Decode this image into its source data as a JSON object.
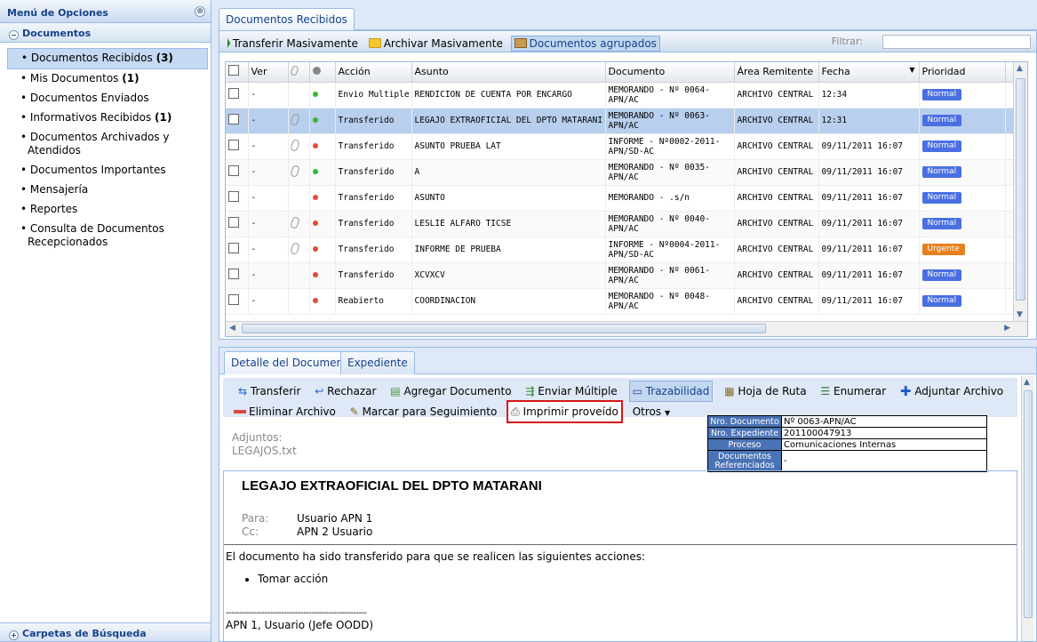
{
  "left": {
    "title": "Menú de Opciones",
    "close_glyph": "⊗",
    "section": "Documentos",
    "section_toggle": "−",
    "items": [
      {
        "label": "• Documentos Recibidos",
        "count": "(3)"
      },
      {
        "label": "• Mis Documentos",
        "count": "(1)"
      },
      {
        "label": "• Documentos Enviados",
        "count": ""
      },
      {
        "label": "• Informativos Recibidos",
        "count": "(1)"
      },
      {
        "label": "• Documentos Archivados y Atendidos",
        "count": ""
      },
      {
        "label": "• Documentos Importantes",
        "count": ""
      },
      {
        "label": "• Mensajería",
        "count": ""
      },
      {
        "label": "• Reportes",
        "count": ""
      },
      {
        "label": "• Consulta de Documentos Recepcionados",
        "count": ""
      }
    ],
    "bottom_section": "Carpetas de Búsqueda",
    "bottom_toggle": "+"
  },
  "main_tab": "Documentos Recibidos",
  "toolbar": {
    "transfer": "Transferir Masivamente",
    "archive": "Archivar Masivamente",
    "grouped": "Documentos agrupados",
    "filter_label": "Filtrar:",
    "filter_value": ""
  },
  "grid": {
    "headers": [
      "",
      "Ver",
      "",
      "",
      "Acción",
      "Asunto",
      "Documento",
      "Área Remitente",
      "Fecha",
      "Prioridad",
      ""
    ],
    "rows": [
      {
        "ver": "-",
        "clip": false,
        "status": "green",
        "accion": "Envio Multiple",
        "asunto": "RENDICION DE CUENTA POR ENCARGO",
        "documento": "MEMORANDO - Nº 0064-APN/AC",
        "area": "ARCHIVO CENTRAL",
        "fecha": "12:34",
        "prioridad": "Normal"
      },
      {
        "ver": "-",
        "clip": true,
        "status": "green",
        "accion": "Transferido",
        "asunto": "LEGAJO EXTRAOFICIAL DEL DPTO MATARANI",
        "documento": "MEMORANDO - Nº 0063-APN/AC",
        "area": "ARCHIVO CENTRAL",
        "fecha": "12:31",
        "prioridad": "Normal"
      },
      {
        "ver": "-",
        "clip": true,
        "status": "red",
        "accion": "Transferido",
        "asunto": "ASUNTO PRUEBA LAT",
        "documento": "INFORME - Nº0002-2011-APN/SD-AC",
        "area": "ARCHIVO CENTRAL",
        "fecha": "09/11/2011 16:07",
        "prioridad": "Normal"
      },
      {
        "ver": "-",
        "clip": true,
        "status": "green",
        "accion": "Transferido",
        "asunto": "A",
        "documento": "MEMORANDO - Nº 0035-APN/AC",
        "area": "ARCHIVO CENTRAL",
        "fecha": "09/11/2011 16:07",
        "prioridad": "Normal"
      },
      {
        "ver": "-",
        "clip": false,
        "status": "red",
        "accion": "Transferido",
        "asunto": "ASUNTO",
        "documento": "MEMORANDO - .s/n",
        "area": "ARCHIVO CENTRAL",
        "fecha": "09/11/2011 16:07",
        "prioridad": "Normal"
      },
      {
        "ver": "-",
        "clip": true,
        "status": "red",
        "accion": "Transferido",
        "asunto": "LESLIE ALFARO TICSE",
        "documento": "MEMORANDO - Nº 0040-APN/AC",
        "area": "ARCHIVO CENTRAL",
        "fecha": "09/11/2011 16:07",
        "prioridad": "Normal"
      },
      {
        "ver": "-",
        "clip": true,
        "status": "red",
        "accion": "Transferido",
        "asunto": "INFORME DE PRUEBA",
        "documento": "INFORME - Nº0004-2011-APN/SD-AC",
        "area": "ARCHIVO CENTRAL",
        "fecha": "09/11/2011 16:07",
        "prioridad": "Urgente"
      },
      {
        "ver": "-",
        "clip": false,
        "status": "red",
        "accion": "Transferido",
        "asunto": "XCVXCV",
        "documento": "MEMORANDO - Nº 0061-APN/AC",
        "area": "ARCHIVO CENTRAL",
        "fecha": "09/11/2011 16:07",
        "prioridad": "Normal"
      },
      {
        "ver": "-",
        "clip": false,
        "status": "red",
        "accion": "Reabierto",
        "asunto": "COORDINACION",
        "documento": "MEMORANDO - Nº 0048-APN/AC",
        "area": "ARCHIVO CENTRAL",
        "fecha": "09/11/2011 16:07",
        "prioridad": "Normal"
      }
    ]
  },
  "detail_tabs": [
    "Detalle del Documento",
    "Expediente"
  ],
  "actions": {
    "transferir": "Transferir",
    "rechazar": "Rechazar",
    "agregar": "Agregar Documento",
    "enviar": "Enviar Múltiple",
    "trazabilidad": "Trazabilidad",
    "hoja": "Hoja de Ruta",
    "enumerar": "Enumerar",
    "adjuntar": "Adjuntar Archivo",
    "eliminar": "Eliminar Archivo",
    "marcar": "Marcar para Seguimiento",
    "imprimir": "Imprimir proveído",
    "otros": "Otros"
  },
  "info": {
    "nro_doc_label": "Nro. Documento",
    "nro_doc": "Nº 0063-APN/AC",
    "nro_exp_label": "Nro. Expediente",
    "nro_exp": "201100047913",
    "proceso_label": "Proceso",
    "proceso": "Comunicaciones Internas",
    "ref_label": "Documentos Referenciados",
    "ref": "-"
  },
  "adjuntos": {
    "label": "Adjuntos:",
    "file": "LEGAJOS.txt"
  },
  "doc": {
    "title": "LEGAJO EXTRAOFICIAL DEL DPTO MATARANI",
    "para_label": "Para:",
    "para": "Usuario APN 1",
    "cc_label": "Cc:",
    "cc": "APN 2 Usuario",
    "body": "El documento ha sido transferido para que se realicen las siguientes acciones:",
    "bullet": "Tomar acción",
    "dashes": "---------------------------------------------------",
    "sign": "APN 1, Usuario (Jefe OODD)"
  },
  "colors": {
    "normal": "#4a6fe3",
    "urgente": "#e8801d",
    "green": "#33b833",
    "red": "#e34c3a"
  }
}
